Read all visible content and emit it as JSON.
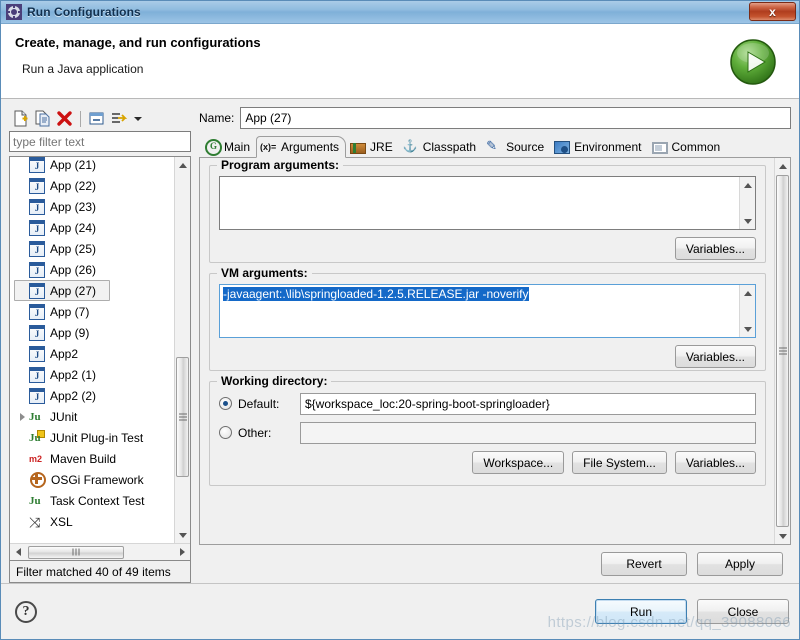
{
  "window": {
    "title": "Run Configurations",
    "title_icon": "gear-icon",
    "close_label": "x"
  },
  "header": {
    "title": "Create, manage, and run configurations",
    "subtitle": "Run a Java application",
    "badge_icon": "run-play-icon"
  },
  "tree_toolbar": {
    "icons": [
      {
        "name": "new-configuration-icon",
        "glyph": "new"
      },
      {
        "name": "duplicate-configuration-icon",
        "glyph": "copy"
      },
      {
        "name": "delete-configuration-icon",
        "glyph": "delete"
      },
      {
        "name": "collapse-all-icon",
        "glyph": "collapse"
      },
      {
        "name": "filter-configurations-icon",
        "glyph": "filter"
      }
    ],
    "dropdown_icon": "chevron-down-icon"
  },
  "filter": {
    "placeholder": "type filter text",
    "value": "",
    "status": "Filter matched 40 of 49 items"
  },
  "tree": {
    "items": [
      {
        "label": "App (21)",
        "icon": "java-application-icon",
        "level": 1,
        "expandable": false,
        "selected": false
      },
      {
        "label": "App (22)",
        "icon": "java-application-icon",
        "level": 1,
        "expandable": false,
        "selected": false
      },
      {
        "label": "App (23)",
        "icon": "java-application-icon",
        "level": 1,
        "expandable": false,
        "selected": false
      },
      {
        "label": "App (24)",
        "icon": "java-application-icon",
        "level": 1,
        "expandable": false,
        "selected": false
      },
      {
        "label": "App (25)",
        "icon": "java-application-icon",
        "level": 1,
        "expandable": false,
        "selected": false
      },
      {
        "label": "App (26)",
        "icon": "java-application-icon",
        "level": 1,
        "expandable": false,
        "selected": false
      },
      {
        "label": "App (27)",
        "icon": "java-application-icon",
        "level": 1,
        "expandable": false,
        "selected": true
      },
      {
        "label": "App (7)",
        "icon": "java-application-icon",
        "level": 1,
        "expandable": false,
        "selected": false
      },
      {
        "label": "App (9)",
        "icon": "java-application-icon",
        "level": 1,
        "expandable": false,
        "selected": false
      },
      {
        "label": "App2",
        "icon": "java-application-icon",
        "level": 1,
        "expandable": false,
        "selected": false
      },
      {
        "label": "App2 (1)",
        "icon": "java-application-icon",
        "level": 1,
        "expandable": false,
        "selected": false
      },
      {
        "label": "App2 (2)",
        "icon": "java-application-icon",
        "level": 1,
        "expandable": false,
        "selected": false
      },
      {
        "label": "JUnit",
        "icon": "junit-icon",
        "level": 0,
        "expandable": true,
        "selected": false
      },
      {
        "label": "JUnit Plug-in Test",
        "icon": "junit-plugin-test-icon",
        "level": 0,
        "expandable": false,
        "selected": false
      },
      {
        "label": "Maven Build",
        "icon": "maven-icon",
        "level": 0,
        "expandable": false,
        "selected": false
      },
      {
        "label": "OSGi Framework",
        "icon": "osgi-icon",
        "level": 0,
        "expandable": false,
        "selected": false
      },
      {
        "label": "Task Context Test",
        "icon": "task-context-test-icon",
        "level": 0,
        "expandable": false,
        "selected": false
      },
      {
        "label": "XSL",
        "icon": "xsl-icon",
        "level": 0,
        "expandable": false,
        "selected": false
      }
    ]
  },
  "config": {
    "name_label": "Name:",
    "name_value": "App (27)"
  },
  "tabs": [
    {
      "label": "Main",
      "icon": "main-tab-icon",
      "active": false
    },
    {
      "label": "Arguments",
      "icon": "arguments-tab-icon",
      "active": true
    },
    {
      "label": "JRE",
      "icon": "jre-tab-icon",
      "active": false
    },
    {
      "label": "Classpath",
      "icon": "classpath-tab-icon",
      "active": false
    },
    {
      "label": "Source",
      "icon": "source-tab-icon",
      "active": false
    },
    {
      "label": "Environment",
      "icon": "environment-tab-icon",
      "active": false
    },
    {
      "label": "Common",
      "icon": "common-tab-icon",
      "active": false
    }
  ],
  "arguments_tab": {
    "program_arguments": {
      "title": "Program arguments:",
      "value": "",
      "variables_button": "Variables..."
    },
    "vm_arguments": {
      "title": "VM arguments:",
      "value": "-javaagent:.\\lib\\springloaded-1.2.5.RELEASE.jar -noverify",
      "selected": true,
      "variables_button": "Variables..."
    },
    "working_directory": {
      "title": "Working directory:",
      "default_label": "Default:",
      "default_selected": true,
      "default_value": "${workspace_loc:20-spring-boot-springloader}",
      "other_label": "Other:",
      "other_selected": false,
      "other_value": "",
      "workspace_button": "Workspace...",
      "file_system_button": "File System...",
      "variables_button": "Variables..."
    }
  },
  "actions": {
    "revert": "Revert",
    "apply": "Apply",
    "run": "Run",
    "close": "Close",
    "help_icon": "help-icon",
    "help_glyph": "?"
  },
  "watermark": "https://blog.csdn.net/qq_39088066",
  "colors": {
    "selection_blue": "#1469c8",
    "title_blue": "#8fbbdf",
    "close_red": "#b03d1e",
    "run_green": "#4a9c28"
  }
}
